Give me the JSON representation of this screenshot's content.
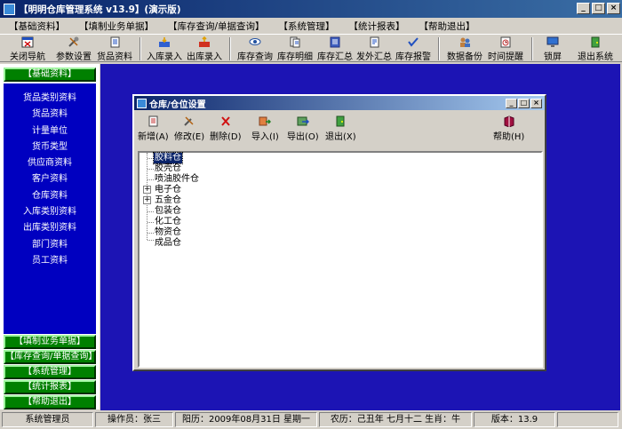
{
  "window": {
    "title": "【明明仓库管理系统 v13.9】(演示版)"
  },
  "menu": [
    "【基础资料】",
    "【填制业务单据】",
    "【库存查询/单据查询】",
    "【系统管理】",
    "【统计报表】",
    "【帮助退出】"
  ],
  "toolbar": {
    "close_nav": "关闭导航",
    "params": "参数设置",
    "goods": "货品资料",
    "stock_in": "入库录入",
    "stock_out": "出库录入",
    "query": "库存查询",
    "detail": "库存明细",
    "summary": "库存汇总",
    "outsource": "发外汇总",
    "alert": "库存报警",
    "backup": "数据备份",
    "reminder": "时间提醒",
    "lock": "锁屏",
    "exit": "退出系统"
  },
  "nav": {
    "header_basic": "【基础资料】",
    "items": [
      "货品类别资料",
      "货品资料",
      "计量单位",
      "货币类型",
      "供应商资料",
      "客户资料",
      "仓库资料",
      "入库类别资料",
      "出库类别资料",
      "部门资料",
      "员工资料"
    ],
    "footer": [
      "【填制业务单据】",
      "【库存查询/单据查询】",
      "【系统管理】",
      "【统计报表】",
      "【帮助退出】"
    ]
  },
  "dialog": {
    "title": "仓库/仓位设置",
    "buttons": {
      "add": "新增(A)",
      "edit": "修改(E)",
      "delete": "删除(D)",
      "import": "导入(I)",
      "export": "导出(O)",
      "quit": "退出(X)",
      "help": "帮助(H)"
    },
    "tree": [
      {
        "label": "胶料仓",
        "expandable": false,
        "selected": true
      },
      {
        "label": "胶壳仓",
        "expandable": false,
        "selected": false
      },
      {
        "label": "喷油胶件仓",
        "expandable": false,
        "selected": false
      },
      {
        "label": "电子仓",
        "expandable": true,
        "selected": false
      },
      {
        "label": "五金仓",
        "expandable": true,
        "selected": false
      },
      {
        "label": "包装仓",
        "expandable": false,
        "selected": false
      },
      {
        "label": "化工仓",
        "expandable": false,
        "selected": false
      },
      {
        "label": "物资仓",
        "expandable": false,
        "selected": false
      },
      {
        "label": "成品仓",
        "expandable": false,
        "selected": false
      }
    ]
  },
  "status": {
    "role": "系统管理员",
    "operator": "操作员：张三",
    "solar": "阳历：2009年08月31日 星期一",
    "lunar": "农历：己丑年 七月十二 生肖：牛",
    "version": "版本：13.9"
  },
  "colors": {
    "nav_header": "#008000",
    "nav_panel": "#0000c0",
    "workspace": "#1c14b4",
    "title_bar": "#0a246a"
  }
}
